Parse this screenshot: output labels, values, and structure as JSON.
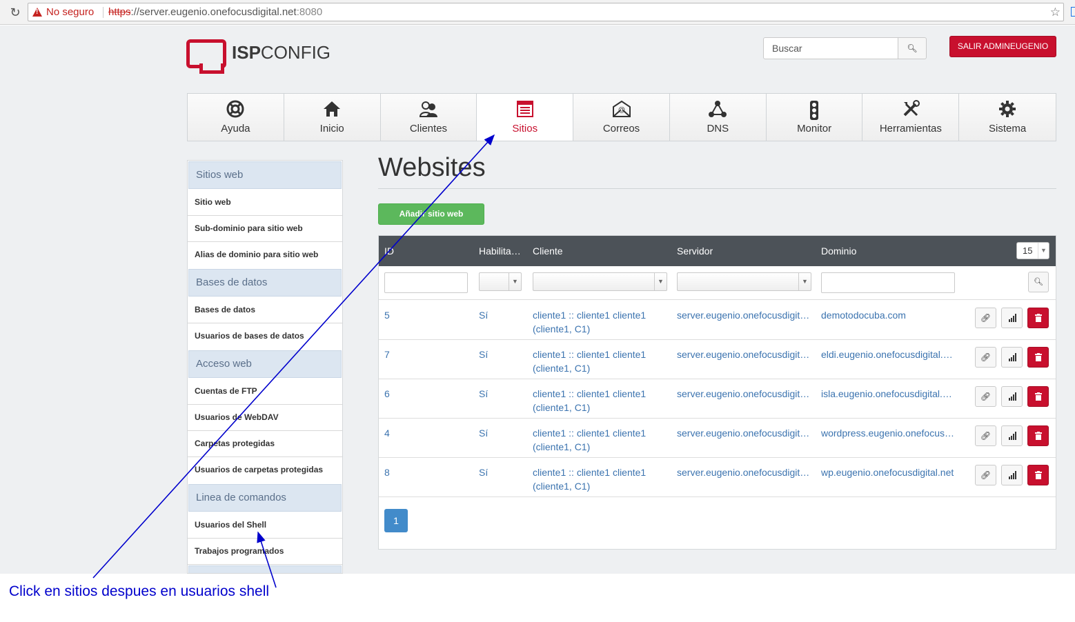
{
  "browser": {
    "security_label": "No seguro",
    "url_scheme": "https",
    "url_host": "://server.eugenio.onefocusdigital.net",
    "url_port": ":8080"
  },
  "header": {
    "logo_bold": "ISP",
    "logo_rest": "CONFIG",
    "search_placeholder": "Buscar",
    "logout_label": "SALIR ADMINEUGENIO"
  },
  "nav": [
    {
      "label": "Ayuda",
      "icon": "lifebuoy-icon"
    },
    {
      "label": "Inicio",
      "icon": "home-icon"
    },
    {
      "label": "Clientes",
      "icon": "users-icon"
    },
    {
      "label": "Sitios",
      "icon": "website-icon",
      "active": true
    },
    {
      "label": "Correos",
      "icon": "mail-icon"
    },
    {
      "label": "DNS",
      "icon": "network-icon"
    },
    {
      "label": "Monitor",
      "icon": "traffic-light-icon"
    },
    {
      "label": "Herramientas",
      "icon": "tools-icon"
    },
    {
      "label": "Sistema",
      "icon": "gear-icon"
    }
  ],
  "sidebar": {
    "sections": [
      {
        "title": "Sitios web",
        "items": [
          "Sitio web",
          "Sub-dominio para sitio web",
          "Alias de dominio para sitio web"
        ]
      },
      {
        "title": "Bases de datos",
        "items": [
          "Bases de datos",
          "Usuarios de bases de datos"
        ]
      },
      {
        "title": "Acceso web",
        "items": [
          "Cuentas de FTP",
          "Usuarios de WebDAV",
          "Carpetas protegidas",
          "Usuarios de carpetas protegidas"
        ]
      },
      {
        "title": "Linea de comandos",
        "items": [
          "Usuarios del Shell",
          "Trabajos programados"
        ]
      }
    ]
  },
  "main": {
    "title": "Websites",
    "add_button": "Añadir sitio web",
    "columns": [
      "ID",
      "Habilita…",
      "Cliente",
      "Servidor",
      "Dominio"
    ],
    "per_page": "15",
    "rows": [
      {
        "id": "5",
        "active": "Sí",
        "client": "cliente1 :: cliente1 cliente1",
        "client2": "(cliente1, C1)",
        "server": "server.eugenio.onefocusdigit…",
        "domain": "demotodocuba.com"
      },
      {
        "id": "7",
        "active": "Sí",
        "client": "cliente1 :: cliente1 cliente1",
        "client2": "(cliente1, C1)",
        "server": "server.eugenio.onefocusdigit…",
        "domain": "eldi.eugenio.onefocusdigital.…"
      },
      {
        "id": "6",
        "active": "Sí",
        "client": "cliente1 :: cliente1 cliente1",
        "client2": "(cliente1, C1)",
        "server": "server.eugenio.onefocusdigit…",
        "domain": "isla.eugenio.onefocusdigital.…"
      },
      {
        "id": "4",
        "active": "Sí",
        "client": "cliente1 :: cliente1 cliente1",
        "client2": "(cliente1, C1)",
        "server": "server.eugenio.onefocusdigit…",
        "domain": "wordpress.eugenio.onefocus…"
      },
      {
        "id": "8",
        "active": "Sí",
        "client": "cliente1 :: cliente1 cliente1",
        "client2": "(cliente1, C1)",
        "server": "server.eugenio.onefocusdigit…",
        "domain": "wp.eugenio.onefocusdigital.net"
      }
    ],
    "page": "1"
  },
  "annotation": {
    "text": "Click en sitios despues en usuarios shell"
  },
  "colors": {
    "brand_red": "#c8102e",
    "link_blue": "#3b73af",
    "table_header": "#4c5258",
    "add_green": "#5cb85c",
    "annotation_blue": "#0000cc"
  }
}
